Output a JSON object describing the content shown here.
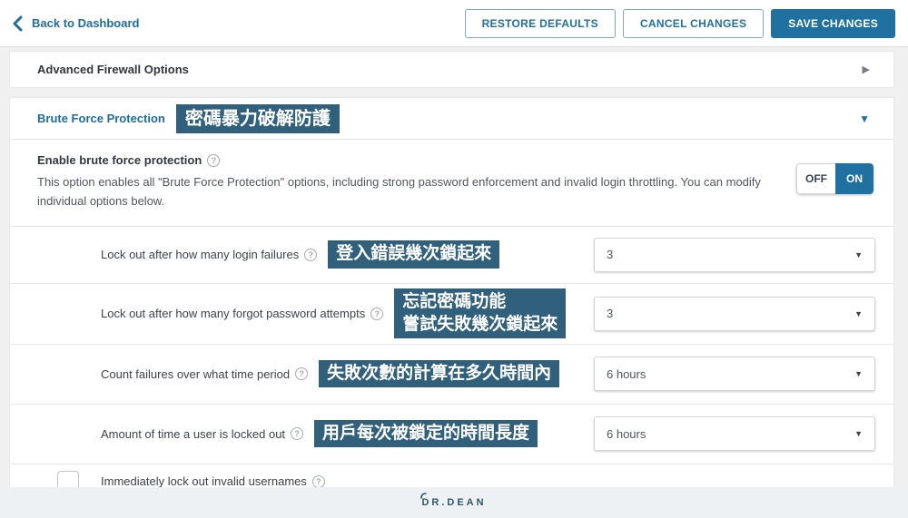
{
  "header": {
    "back_label": "Back to Dashboard",
    "restore_label": "RESTORE DEFAULTS",
    "cancel_label": "CANCEL CHANGES",
    "save_label": "SAVE CHANGES"
  },
  "firewall_section": {
    "title": "Advanced Firewall Options"
  },
  "brute_force": {
    "title": "Brute Force Protection",
    "annotation": "密碼暴力破解防護",
    "enable": {
      "label": "Enable brute force protection",
      "description": "This option enables all \"Brute Force Protection\" options, including strong password enforcement and invalid login throttling. You can modify individual options below.",
      "toggle": {
        "off": "OFF",
        "on": "ON",
        "state": "on"
      }
    },
    "rows": [
      {
        "label": "Lock out after how many login failures",
        "annotation": "登入錯誤幾次鎖起來",
        "value": "3"
      },
      {
        "label": "Lock out after how many forgot password attempts",
        "annotation": "忘記密碼功能\n嘗試失敗幾次鎖起來",
        "value": "3"
      },
      {
        "label": "Count failures over what time period",
        "annotation": "失敗次數的計算在多久時間內",
        "value": "6 hours"
      },
      {
        "label": "Amount of time a user is locked out",
        "annotation": "用戶每次被鎖定的時間長度",
        "value": "6 hours"
      }
    ],
    "checkbox_row": {
      "label": "Immediately lock out invalid usernames",
      "checked": false
    }
  },
  "footer": {
    "logo": "DR.DEAN"
  },
  "icons": {
    "help": "?",
    "dropdown_caret": "▼",
    "section_expanded": "▼",
    "section_collapsed": "▶"
  },
  "colors": {
    "accent": "#2070a0",
    "annotation_bg": "#31607d"
  }
}
